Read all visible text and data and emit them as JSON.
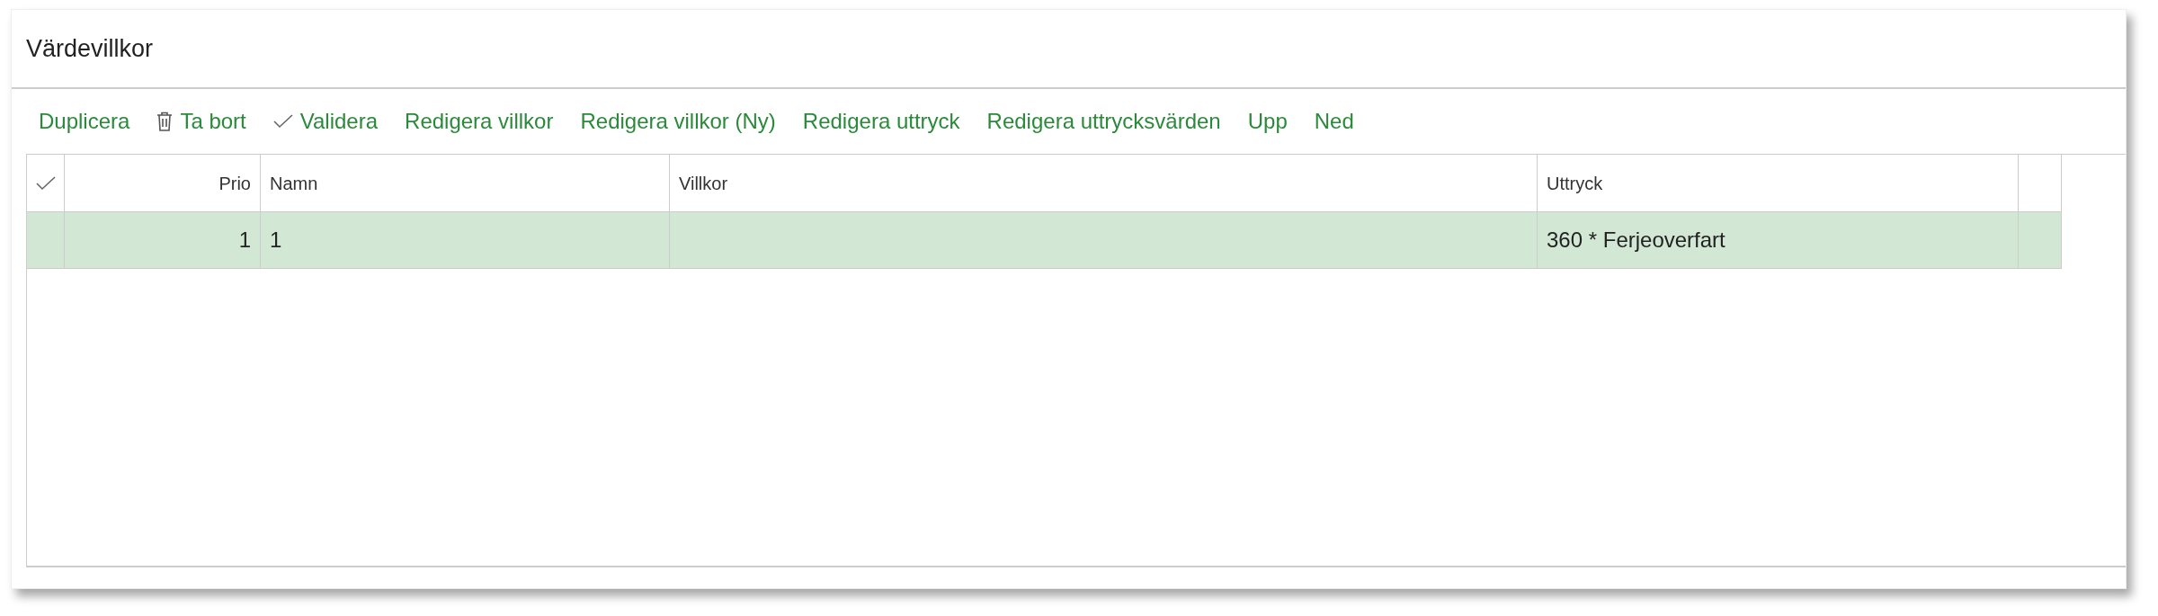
{
  "title": "Värdevillkor",
  "toolbar": [
    {
      "label": "Duplicera",
      "kind": "plain"
    },
    {
      "label": "Ta bort",
      "kind": "delete"
    },
    {
      "label": "Validera",
      "kind": "validate"
    },
    {
      "label": "Redigera villkor",
      "kind": "plain"
    },
    {
      "label": "Redigera villkor (Ny)",
      "kind": "plain"
    },
    {
      "label": "Redigera uttryck",
      "kind": "plain"
    },
    {
      "label": "Redigera uttrycksvärden",
      "kind": "plain"
    },
    {
      "label": "Upp",
      "kind": "plain"
    },
    {
      "label": "Ned",
      "kind": "plain"
    }
  ],
  "table": {
    "columns": [
      "Prio",
      "Namn",
      "Villkor",
      "Uttryck"
    ],
    "rows": [
      {
        "selected": true,
        "cells": [
          "1",
          "1",
          "",
          "360 * Ferjeoverfart"
        ]
      }
    ]
  }
}
